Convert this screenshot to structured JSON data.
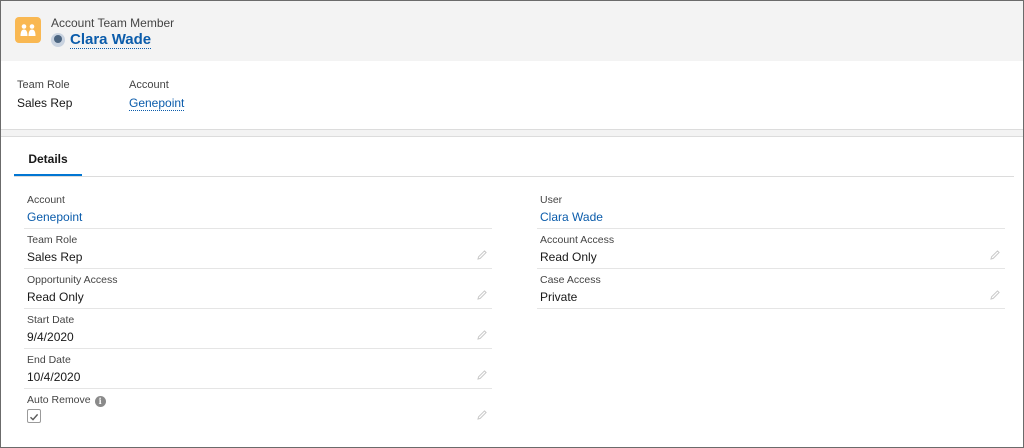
{
  "header": {
    "object_label": "Account Team Member",
    "record_name": "Clara Wade",
    "object_icon": "account-team-icon",
    "icon_color": "#f9b852"
  },
  "highlights": [
    {
      "label": "Team Role",
      "value": "Sales Rep"
    },
    {
      "label": "Account",
      "value": "Genepoint"
    }
  ],
  "tabs": [
    {
      "label": "Details"
    }
  ],
  "details": {
    "left": [
      {
        "label": "Account",
        "value": "Genepoint"
      },
      {
        "label": "Team Role",
        "value": "Sales Rep"
      },
      {
        "label": "Opportunity Access",
        "value": "Read Only"
      },
      {
        "label": "Start Date",
        "value": "9/4/2020"
      },
      {
        "label": "End Date",
        "value": "10/4/2020"
      },
      {
        "label": "Auto Remove",
        "checked": true
      }
    ],
    "right": [
      {
        "label": "User",
        "value": "Clara Wade"
      },
      {
        "label": "Account Access",
        "value": "Read Only"
      },
      {
        "label": "Case Access",
        "value": "Private"
      }
    ]
  },
  "colors": {
    "link": "#0b5cab",
    "tab_underline": "#0176d3",
    "header_bg": "#f3f3f3"
  }
}
